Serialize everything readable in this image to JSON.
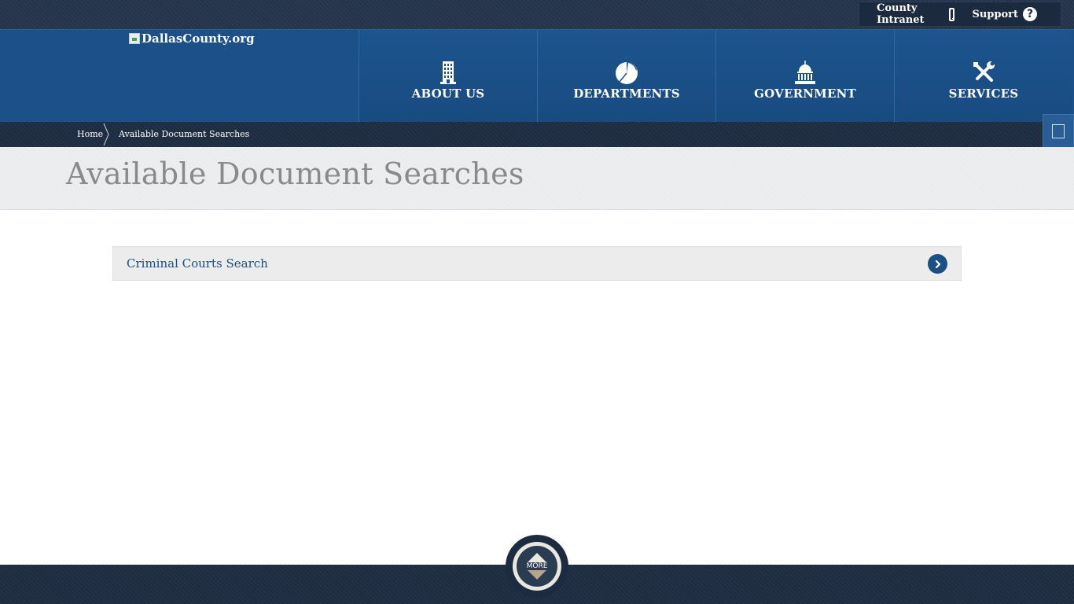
{
  "topbar": {
    "intranet_label": "County Intranet",
    "intranet_icon": "mobile-phone-icon",
    "support_label": "Support",
    "support_icon": "question-circle-icon"
  },
  "header": {
    "logo_alt": "DallasCounty.org",
    "nav": [
      {
        "label": "ABOUT US",
        "icon": "building-icon"
      },
      {
        "label": "DEPARTMENTS",
        "icon": "pie-chart-icon"
      },
      {
        "label": "GOVERNMENT",
        "icon": "capitol-icon"
      },
      {
        "label": "SERVICES",
        "icon": "tools-icon"
      }
    ]
  },
  "breadcrumb": {
    "home": "Home",
    "current": "Available Document Searches"
  },
  "page": {
    "title": "Available Document Searches",
    "items": [
      {
        "label": "Criminal Courts Search"
      }
    ]
  },
  "footer": {
    "more_label": "MORE"
  },
  "colors": {
    "header_blue": "#1b5088",
    "dark_navy": "#1d2b40",
    "link_blue": "#1b4f86",
    "title_gray": "#8a8a8a"
  }
}
